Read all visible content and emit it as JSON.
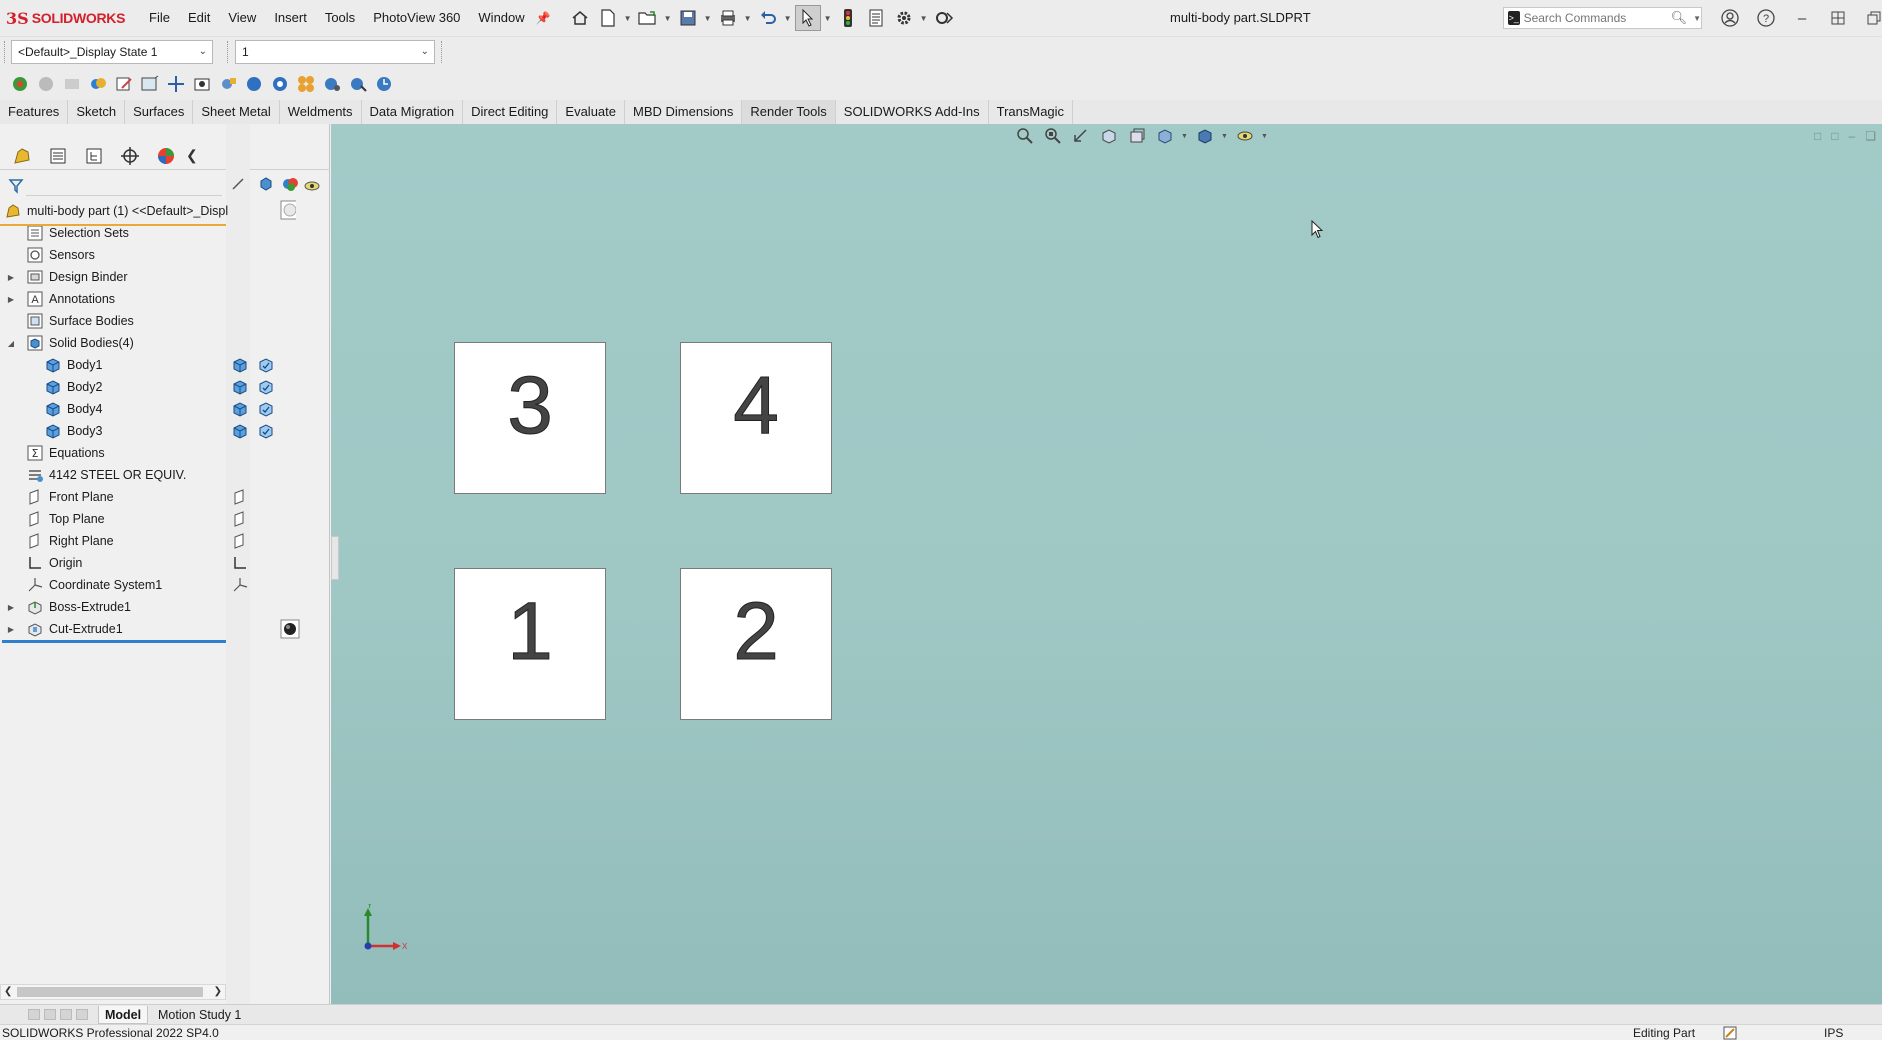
{
  "app": {
    "logo_ds": "3S",
    "logo_text": "SOLIDWORKS",
    "document_title": "multi-body part.SLDPRT",
    "accent_color": "#d4202a"
  },
  "menu": [
    "File",
    "Edit",
    "View",
    "Insert",
    "Tools",
    "PhotoView 360",
    "Window"
  ],
  "search": {
    "placeholder": "Search Commands"
  },
  "config": {
    "display_state": "<Default>_Display State 1",
    "config_value": "1"
  },
  "command_tabs": {
    "items": [
      "Features",
      "Sketch",
      "Surfaces",
      "Sheet Metal",
      "Weldments",
      "Data Migration",
      "Direct Editing",
      "Evaluate",
      "MBD Dimensions",
      "Render Tools",
      "SOLIDWORKS Add-Ins",
      "TransMagic"
    ],
    "active": "Render Tools"
  },
  "tree": {
    "root": "multi-body part (1) <<Default>_Displ",
    "items": [
      {
        "label": "Selection Sets",
        "icon": "selection-sets-icon",
        "expandable": false
      },
      {
        "label": "Sensors",
        "icon": "sensors-icon",
        "expandable": false
      },
      {
        "label": "Design Binder",
        "icon": "design-binder-icon",
        "expandable": true
      },
      {
        "label": "Annotations",
        "icon": "annotations-icon",
        "expandable": true
      },
      {
        "label": "Surface Bodies",
        "icon": "surface-bodies-icon",
        "expandable": false
      },
      {
        "label": "Solid Bodies(4)",
        "icon": "solid-bodies-icon",
        "expandable": true,
        "expanded": true
      },
      {
        "label": "Body1",
        "icon": "body-icon",
        "child": true
      },
      {
        "label": "Body2",
        "icon": "body-icon",
        "child": true
      },
      {
        "label": "Body4",
        "icon": "body-icon",
        "child": true
      },
      {
        "label": "Body3",
        "icon": "body-icon",
        "child": true
      },
      {
        "label": "Equations",
        "icon": "equations-icon",
        "expandable": false
      },
      {
        "label": "4142 STEEL OR EQUIV.",
        "icon": "material-icon",
        "expandable": false
      },
      {
        "label": "Front Plane",
        "icon": "plane-icon",
        "expandable": false
      },
      {
        "label": "Top Plane",
        "icon": "plane-icon",
        "expandable": false
      },
      {
        "label": "Right Plane",
        "icon": "plane-icon",
        "expandable": false
      },
      {
        "label": "Origin",
        "icon": "origin-icon",
        "expandable": false
      },
      {
        "label": "Coordinate System1",
        "icon": "coordinate-system-icon",
        "expandable": false
      },
      {
        "label": "Boss-Extrude1",
        "icon": "boss-extrude-icon",
        "expandable": true
      },
      {
        "label": "Cut-Extrude1",
        "icon": "cut-extrude-icon",
        "expandable": true
      }
    ]
  },
  "viewport": {
    "bodies": [
      {
        "label": "3"
      },
      {
        "label": "4"
      },
      {
        "label": "1"
      },
      {
        "label": "2"
      }
    ],
    "triad_x": "X",
    "triad_y": "Y"
  },
  "bottom_tabs": [
    "Model",
    "Motion Study 1"
  ],
  "status": {
    "product": "SOLIDWORKS Professional 2022 SP4.0",
    "mode": "Editing Part",
    "units": "IPS"
  }
}
